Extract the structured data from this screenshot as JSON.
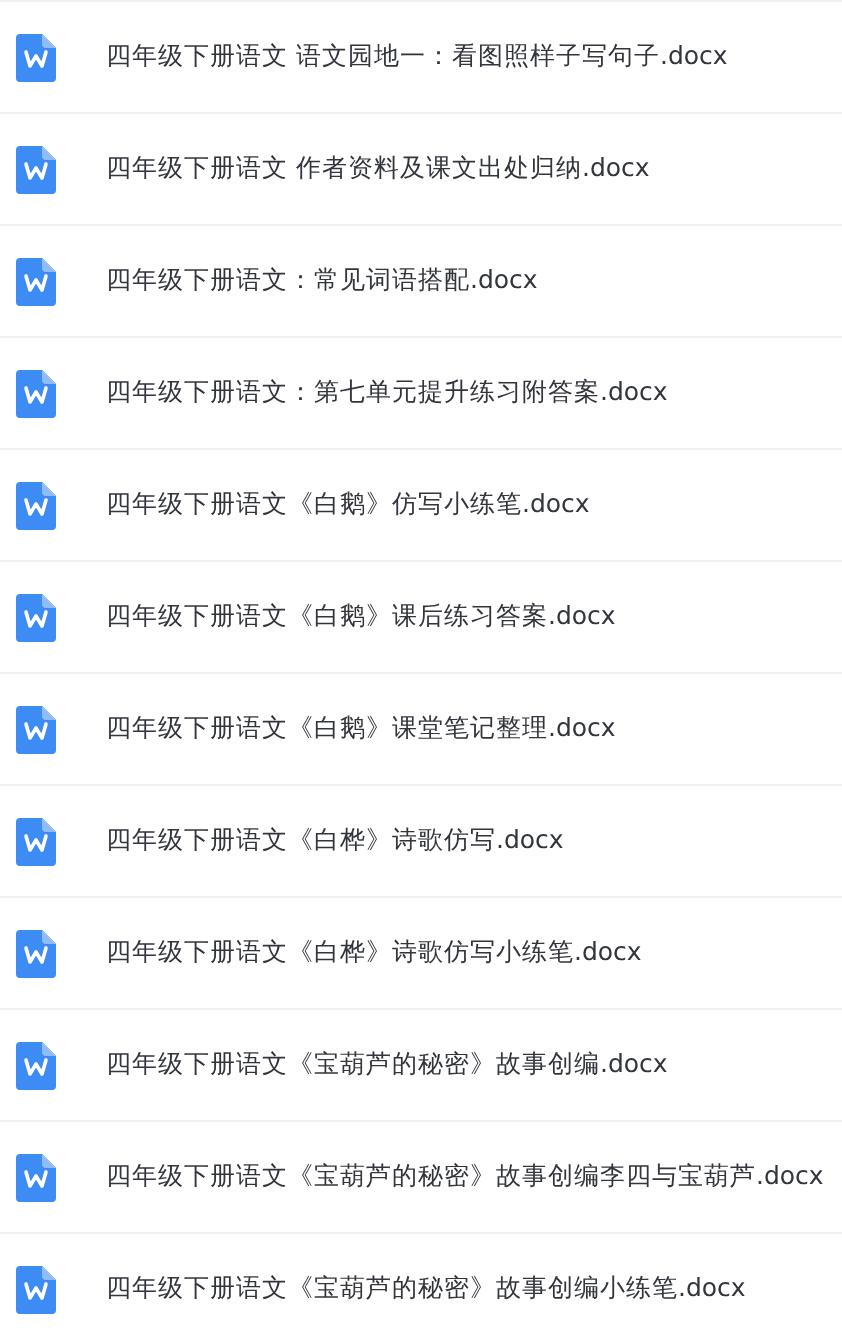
{
  "files": [
    {
      "name": "四年级下册语文 语文园地一：看图照样子写句子.docx"
    },
    {
      "name": "四年级下册语文 作者资料及课文出处归纳.docx"
    },
    {
      "name": "四年级下册语文：常见词语搭配.docx"
    },
    {
      "name": "四年级下册语文：第七单元提升练习附答案.docx"
    },
    {
      "name": "四年级下册语文《白鹅》仿写小练笔.docx"
    },
    {
      "name": "四年级下册语文《白鹅》课后练习答案.docx"
    },
    {
      "name": "四年级下册语文《白鹅》课堂笔记整理.docx"
    },
    {
      "name": "四年级下册语文《白桦》诗歌仿写.docx"
    },
    {
      "name": "四年级下册语文《白桦》诗歌仿写小练笔.docx"
    },
    {
      "name": "四年级下册语文《宝葫芦的秘密》故事创编.docx"
    },
    {
      "name": "四年级下册语文《宝葫芦的秘密》故事创编李四与宝葫芦.docx"
    },
    {
      "name": "四年级下册语文《宝葫芦的秘密》故事创编小练笔.docx"
    }
  ]
}
